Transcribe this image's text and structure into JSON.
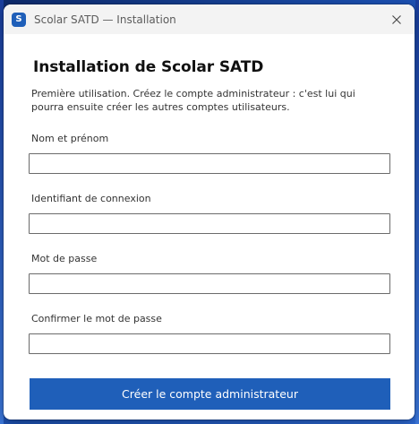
{
  "window": {
    "title": "Scolar SATD — Installation",
    "app_icon_letter": "S",
    "close_icon": "close-icon"
  },
  "form": {
    "heading": "Installation de Scolar SATD",
    "intro": "Première utilisation. Créez le compte administrateur : c'est lui qui pourra ensuite créer les autres comptes utilisateurs.",
    "fields": [
      {
        "label": "Nom et prénom",
        "value": ""
      },
      {
        "label": "Identifiant de connexion",
        "value": ""
      },
      {
        "label": "Mot de passe",
        "value": ""
      },
      {
        "label": "Confirmer le mot de passe",
        "value": ""
      }
    ],
    "submit_label": "Créer le compte administrateur"
  },
  "colors": {
    "accent": "#1f5fb9",
    "titlebar": "#f3f3f3",
    "input_border": "#6b6b6b"
  }
}
